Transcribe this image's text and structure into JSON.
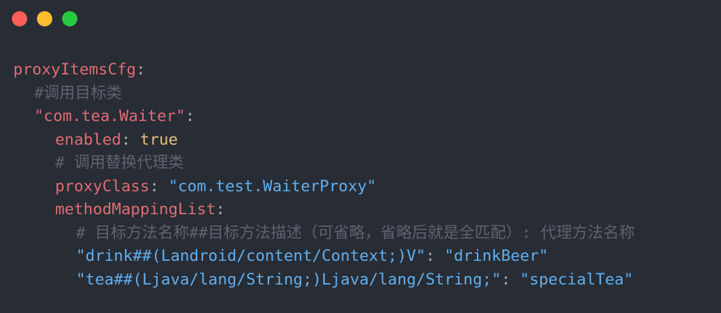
{
  "window": {
    "controls": [
      {
        "name": "close",
        "color": "#ff5f56"
      },
      {
        "name": "minimize",
        "color": "#ffbd2e"
      },
      {
        "name": "maximize",
        "color": "#27c93f"
      }
    ]
  },
  "code": {
    "l1_key": "proxyItemsCfg",
    "colon": ":",
    "l2_comment": "#调用目标类",
    "l3_key": "\"com.tea.Waiter\"",
    "l4_key": "enabled",
    "l4_value": "true",
    "l5_comment": "# 调用替换代理类",
    "l6_key": "proxyClass",
    "l6_value": "\"com.test.WaiterProxy\"",
    "l7_key": "methodMappingList",
    "l8_comment": "# 目标方法名称##目标方法描述（可省略，省略后就是全匹配）: 代理方法名称",
    "l9_key": "\"drink##(Landroid/content/Context;)V\"",
    "l9_value": "\"drinkBeer\"",
    "l10_key": "\"tea##(Ljava/lang/String;)Ljava/lang/String;\"",
    "l10_value": "\"specialTea\""
  }
}
